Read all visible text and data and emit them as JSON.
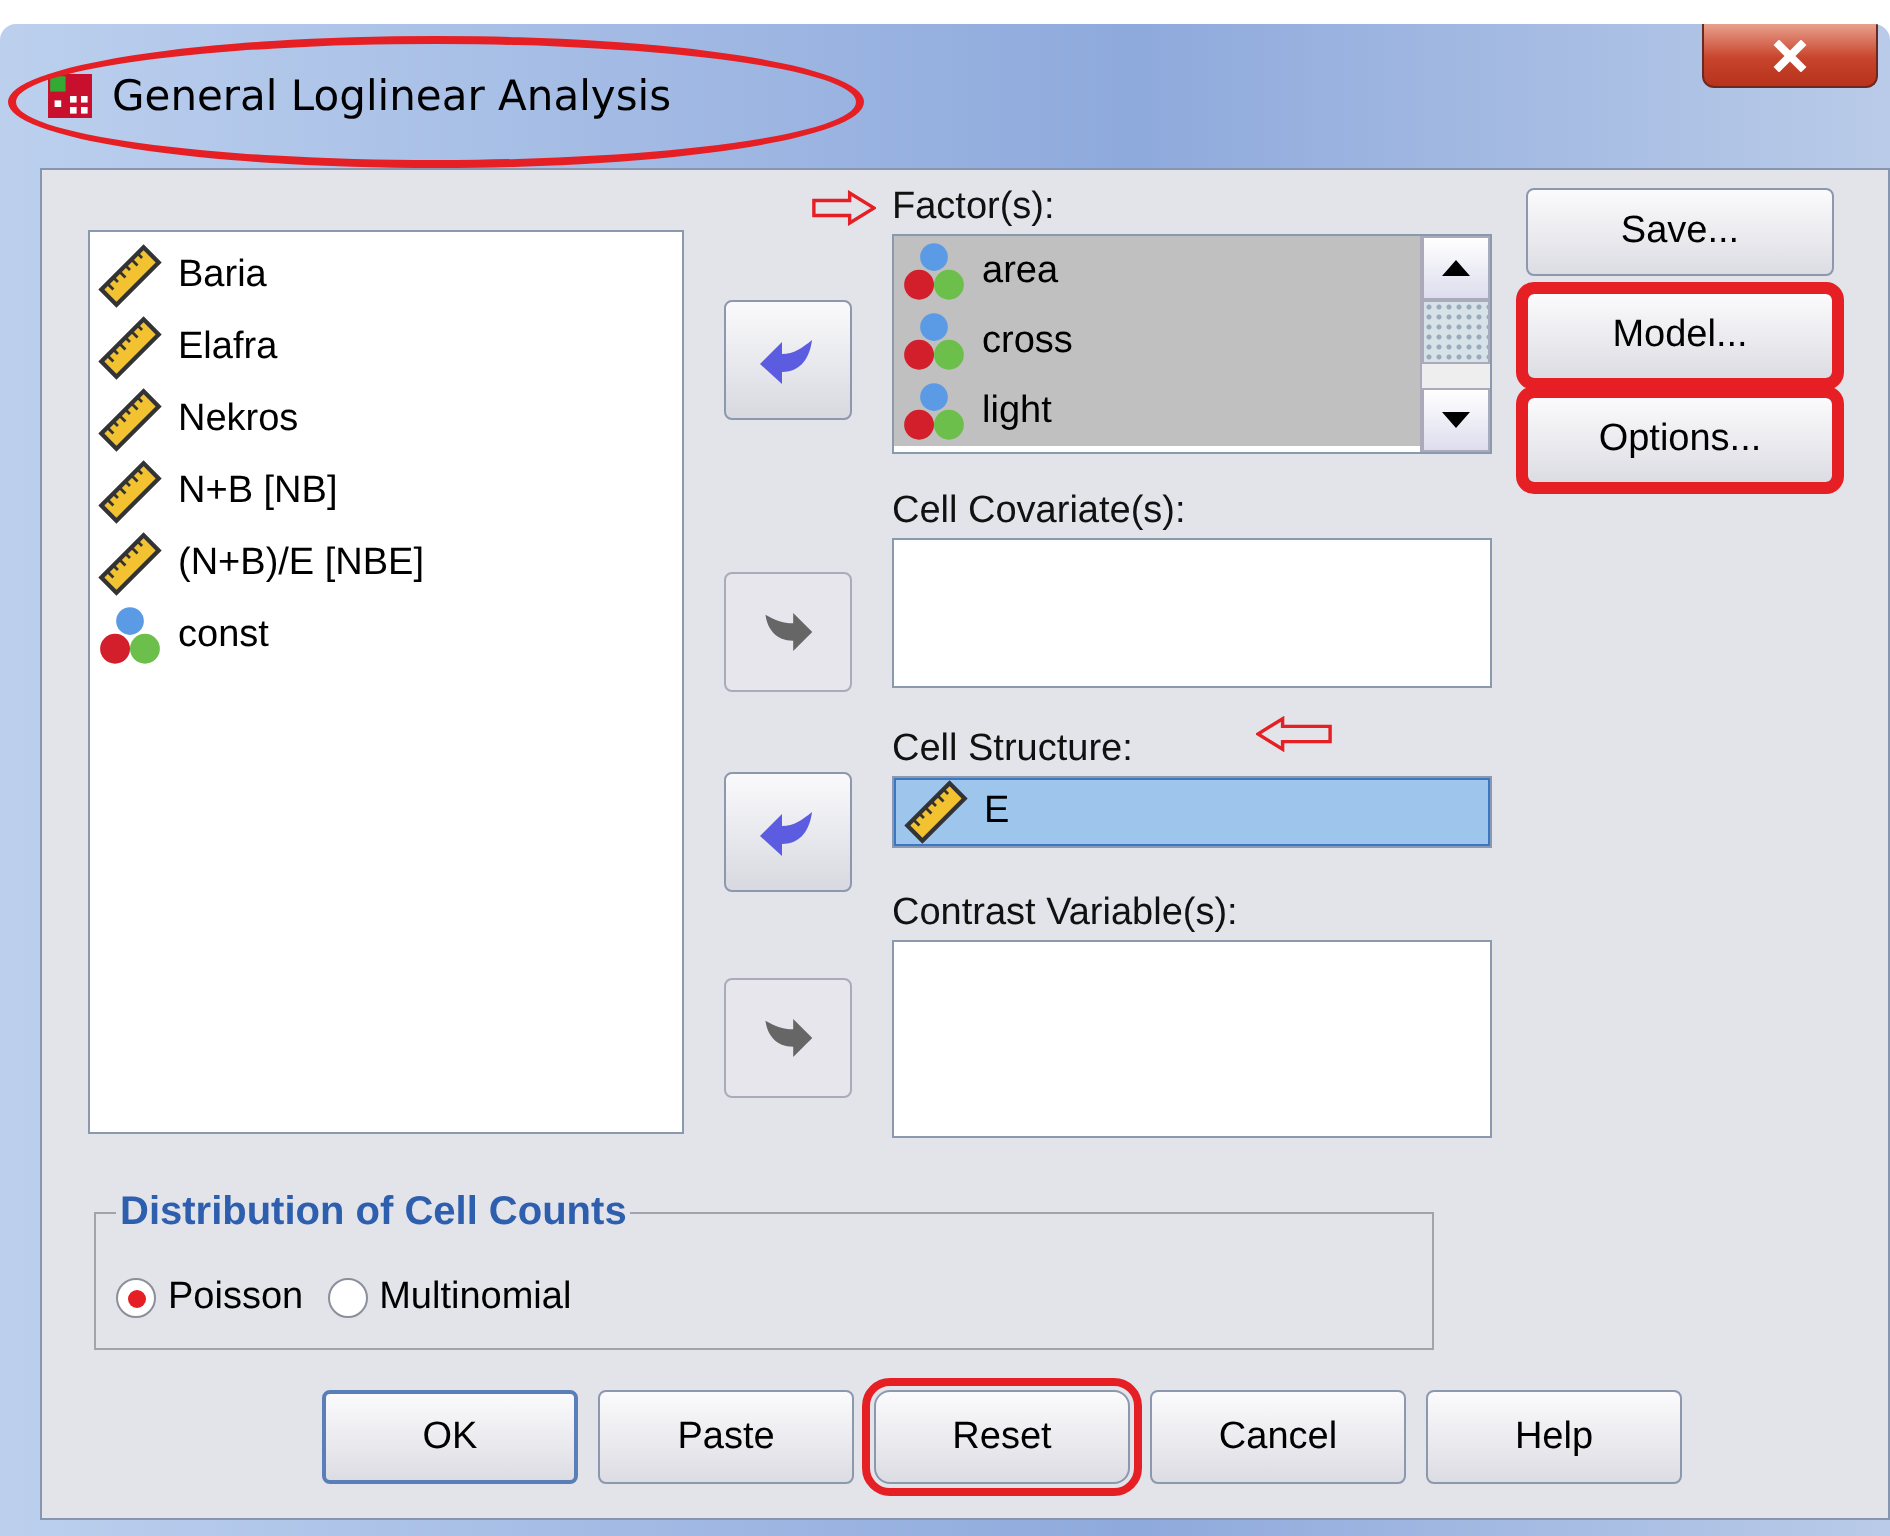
{
  "window": {
    "title": "General Loglinear Analysis",
    "circled": true
  },
  "variables": [
    {
      "name": "Baria",
      "kind": "scale"
    },
    {
      "name": "Elafra",
      "kind": "scale"
    },
    {
      "name": "Nekros",
      "kind": "scale"
    },
    {
      "name": "N+B [NB]",
      "kind": "scale"
    },
    {
      "name": "(N+B)/E [NBE]",
      "kind": "scale"
    },
    {
      "name": "const",
      "kind": "nominal"
    }
  ],
  "targets": [
    {
      "label": "Factor(s):",
      "pointer": {
        "kind": "right"
      },
      "arrow": {
        "kind": "remove",
        "disabled": false
      },
      "focused": false,
      "scrollable": true,
      "items": [
        {
          "name": "area",
          "kind": "nominal",
          "selected": true
        },
        {
          "name": "cross",
          "kind": "nominal",
          "selected": true
        },
        {
          "name": "light",
          "kind": "nominal",
          "selected": true
        }
      ]
    },
    {
      "label": "Cell Covariate(s):",
      "arrow": {
        "kind": "add",
        "disabled": true
      }
    },
    {
      "label": "Cell Structure:",
      "pointer": {
        "kind": "left"
      },
      "arrow": {
        "kind": "remove",
        "disabled": false
      },
      "focused": true,
      "items": [
        {
          "name": "E",
          "kind": "scale",
          "selected": true
        }
      ]
    },
    {
      "label": "Contrast Variable(s):",
      "arrow": {
        "kind": "add",
        "disabled": true
      }
    }
  ],
  "side_buttons": [
    {
      "label": "Save...",
      "boxed": false
    },
    {
      "label": "Model...",
      "boxed": true
    },
    {
      "label": "Options...",
      "boxed": true
    }
  ],
  "distribution": {
    "title": "Distribution of Cell Counts",
    "options": [
      {
        "label": "Poisson",
        "selected": true
      },
      {
        "label": "Multinomial",
        "selected": false
      }
    ]
  },
  "buttons": [
    {
      "label": "OK",
      "default": true,
      "circled": false
    },
    {
      "label": "Paste",
      "default": false,
      "circled": false
    },
    {
      "label": "Reset",
      "default": false,
      "circled": true
    },
    {
      "label": "Cancel",
      "default": false,
      "circled": false
    },
    {
      "label": "Help",
      "default": false,
      "circled": false
    }
  ]
}
